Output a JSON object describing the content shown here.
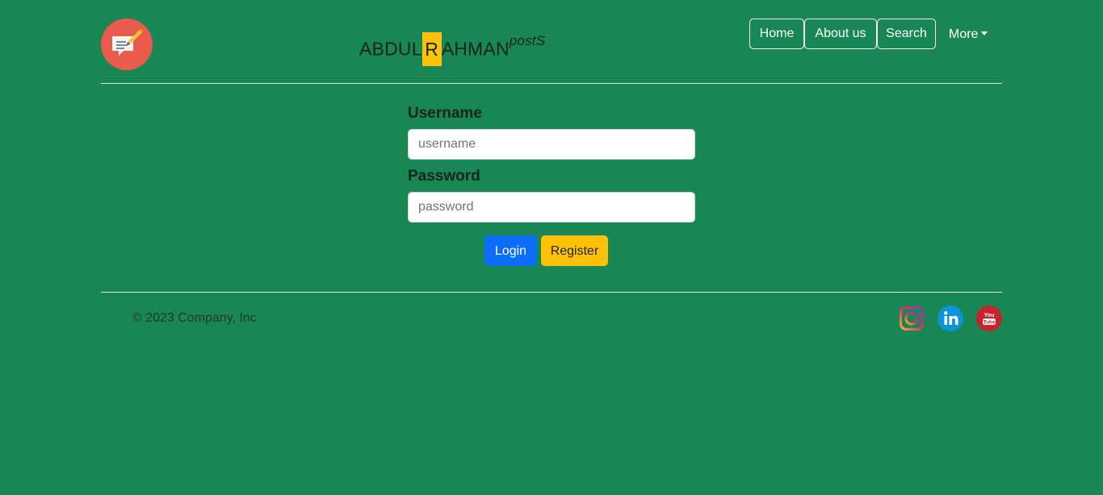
{
  "header": {
    "brand_prefix": "ABDUL",
    "brand_highlight": "R",
    "brand_rest": "AHMAN",
    "brand_suffix": "postS"
  },
  "nav": {
    "home": "Home",
    "about": "About us",
    "search": "Search",
    "more": "More"
  },
  "form": {
    "username_label": "Username",
    "username_placeholder": "username",
    "password_label": "Password",
    "password_placeholder": "password",
    "login_label": "Login",
    "register_label": "Register"
  },
  "footer": {
    "copyright": "© 2023 Company, Inc",
    "social": [
      "instagram-icon",
      "linkedin-icon",
      "youtube-icon"
    ]
  },
  "colors": {
    "background": "#198754",
    "accent_yellow": "#ffc107",
    "primary_blue": "#0d6efd",
    "logo_red": "#e9594c"
  }
}
